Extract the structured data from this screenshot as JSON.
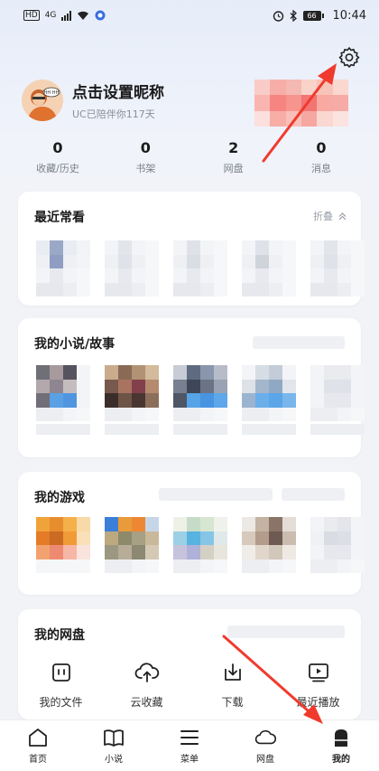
{
  "status_bar": {
    "network": "4G",
    "battery": "66",
    "time": "10:44"
  },
  "profile": {
    "nickname": "点击设置昵称",
    "companion_text": "UC已陪伴你117天",
    "avatar_bubble": "HH HH"
  },
  "stats": [
    {
      "value": "0",
      "label": "收藏/历史"
    },
    {
      "value": "0",
      "label": "书架"
    },
    {
      "value": "2",
      "label": "网盘"
    },
    {
      "value": "0",
      "label": "消息"
    }
  ],
  "recent": {
    "title": "最近常看",
    "fold_label": "折叠"
  },
  "novels": {
    "title": "我的小说/故事"
  },
  "games": {
    "title": "我的游戏"
  },
  "netdisk": {
    "title": "我的网盘",
    "actions": [
      {
        "label": "我的文件",
        "icon": "file-icon"
      },
      {
        "label": "云收藏",
        "icon": "cloud-upload-icon"
      },
      {
        "label": "下载",
        "icon": "download-icon"
      },
      {
        "label": "最近播放",
        "icon": "play-screen-icon"
      }
    ]
  },
  "bottom_nav": [
    {
      "label": "首页",
      "icon": "home-icon"
    },
    {
      "label": "小说",
      "icon": "book-icon"
    },
    {
      "label": "菜单",
      "icon": "menu-icon"
    },
    {
      "label": "网盘",
      "icon": "cloud-icon"
    },
    {
      "label": "我的",
      "icon": "profile-icon"
    }
  ],
  "colors": {
    "accent_red": "#f03a2e",
    "icon_dark": "#222222"
  }
}
